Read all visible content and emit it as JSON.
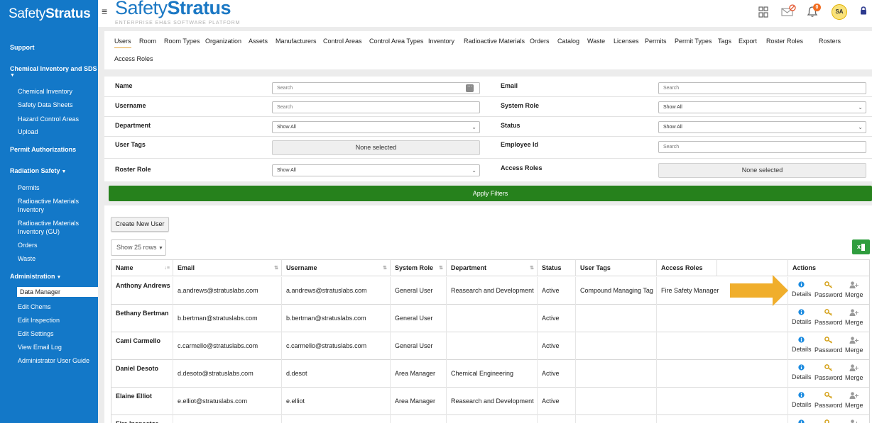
{
  "sidebar": {
    "brand_a": "Safety",
    "brand_b": "Stratus",
    "items": [
      {
        "label": "Support",
        "type": "sec"
      },
      {
        "label": "Chemical Inventory and SDS",
        "type": "sec"
      },
      {
        "label": "Chemical Inventory",
        "type": "sub"
      },
      {
        "label": "Safety Data Sheets",
        "type": "sub"
      },
      {
        "label": "Hazard Control Areas",
        "type": "sub"
      },
      {
        "label": "Upload",
        "type": "sub"
      },
      {
        "label": "Permit Authorizations",
        "type": "sec"
      },
      {
        "label": "Radiation Safety",
        "type": "sec"
      },
      {
        "label": "Permits",
        "type": "sub"
      },
      {
        "label": "Radioactive Materials",
        "type": "sub"
      },
      {
        "label": "Inventory",
        "type": "sub"
      },
      {
        "label": "Radioactive Materials",
        "type": "sub"
      },
      {
        "label": "Inventory (GU)",
        "type": "sub"
      },
      {
        "label": "Orders",
        "type": "sub"
      },
      {
        "label": "Waste",
        "type": "sub"
      },
      {
        "label": "Administration",
        "type": "sec"
      },
      {
        "label": "Data Manager",
        "type": "active"
      },
      {
        "label": "Edit Chems",
        "type": "sub"
      },
      {
        "label": "Edit Inspection",
        "type": "sub"
      },
      {
        "label": "Edit Settings",
        "type": "sub"
      },
      {
        "label": "View Email Log",
        "type": "sub"
      },
      {
        "label": "Administrator User Guide",
        "type": "sub"
      }
    ]
  },
  "header": {
    "logo_a": "Safety",
    "logo_b": "Stratus",
    "tagline": "ENTERPRISE EH&S SOFTWARE PLATFORM",
    "notification_count": "0",
    "avatar_initials": "SA"
  },
  "tabs": [
    "Users",
    "Room",
    "Room Types",
    "Organization",
    "Assets",
    "Manufacturers",
    "Control Areas",
    "Control Area Types",
    "Inventory",
    "Radioactive Materials",
    "Orders",
    "Catalog",
    "Waste",
    "Licenses",
    "Permits",
    "Permit Types",
    "Tags",
    "Export",
    "Roster Roles",
    "Rosters",
    "Access Roles"
  ],
  "filters": {
    "name_label": "Name",
    "name_placeholder": "Search",
    "email_label": "Email",
    "email_placeholder": "Search",
    "username_label": "Username",
    "username_placeholder": "Search",
    "system_role_label": "System Role",
    "system_role_value": "Show All",
    "department_label": "Department",
    "department_value": "Show All",
    "status_label": "Status",
    "status_value": "Show All",
    "user_tags_label": "User Tags",
    "user_tags_value": "None selected",
    "employee_id_label": "Employee Id",
    "employee_id_placeholder": "Search",
    "roster_role_label": "Roster Role",
    "roster_role_value": "Show All",
    "access_roles_label": "Access Roles",
    "access_roles_value": "None selected",
    "apply_label": "Apply Filters"
  },
  "toolbar": {
    "create_label": "Create New User",
    "rows_label": "Show 25 rows",
    "excel_label": "x"
  },
  "table": {
    "headers": [
      "Name",
      "Email",
      "Username",
      "System Role",
      "Department",
      "Status",
      "User Tags",
      "Access Roles",
      "Actions"
    ],
    "actions": [
      "Details",
      "Password",
      "Merge"
    ],
    "rows": [
      {
        "name": "Anthony Andrews",
        "email": "a.andrews@stratuslabs.com",
        "username": "a.andrews@stratuslabs.com",
        "role": "General User",
        "dept": "Reasearch and Development",
        "status": "Active",
        "tags": "Compound Managing Tag",
        "access": "Fire Safety Manager"
      },
      {
        "name": "Bethany Bertman",
        "email": "b.bertman@stratuslabs.com",
        "username": "b.bertman@stratuslabs.com",
        "role": "General User",
        "dept": "",
        "status": "Active",
        "tags": "",
        "access": ""
      },
      {
        "name": "Cami Carmello",
        "email": "c.carmello@stratuslabs.com",
        "username": "c.carmello@stratuslabs.com",
        "role": "General User",
        "dept": "",
        "status": "Active",
        "tags": "",
        "access": ""
      },
      {
        "name": "Daniel Desoto",
        "email": "d.desoto@stratuslabs.com",
        "username": "d.desot",
        "role": "Area Manager",
        "dept": "Chemical Engineering",
        "status": "Active",
        "tags": "",
        "access": ""
      },
      {
        "name": "Elaine Elliot",
        "email": "e.elliot@stratuslabs.com",
        "username": "e.elliot",
        "role": "Area Manager",
        "dept": "Reasearch and Development",
        "status": "Active",
        "tags": "",
        "access": ""
      },
      {
        "name": "Fire Inspector",
        "email": "",
        "username": "",
        "role": "",
        "dept": "",
        "status": "",
        "tags": "",
        "access": ""
      }
    ]
  },
  "colors": {
    "sidebar": "#1378c8",
    "apply": "#26811c",
    "arrow": "#f0ae2c",
    "details_icon": "#1b8be0",
    "key_icon": "#d4a017"
  }
}
